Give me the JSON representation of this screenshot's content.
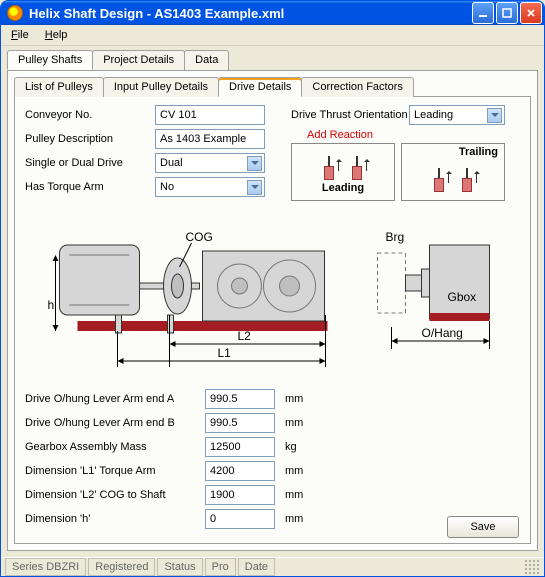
{
  "window": {
    "title": "Helix Shaft Design - AS1403 Example.xml"
  },
  "menu": {
    "file": "File",
    "help": "Help"
  },
  "outer_tabs": {
    "pulley_shafts": "Pulley Shafts",
    "project_details": "Project Details",
    "data": "Data"
  },
  "inner_tabs": {
    "list": "List of Pulleys",
    "input": "Input Pulley Details",
    "drive": "Drive Details",
    "correction": "Correction Factors"
  },
  "fields": {
    "conveyor_no_label": "Conveyor No.",
    "conveyor_no_value": "CV 101",
    "pulley_desc_label": "Pulley Description",
    "pulley_desc_value": "As 1403 Example",
    "single_dual_label": "Single or Dual Drive",
    "single_dual_value": "Dual",
    "torque_arm_label": "Has Torque Arm",
    "torque_arm_value": "No",
    "thrust_label": "Drive Thrust Orientation",
    "thrust_value": "Leading"
  },
  "reaction": {
    "header": "Add Reaction",
    "leading": "Leading",
    "trailing": "Trailing"
  },
  "diagram": {
    "cog": "COG",
    "brg": "Brg",
    "gbox": "Gbox",
    "l1": "L1",
    "l2": "L2",
    "h": "h",
    "ohang": "O/Hang"
  },
  "lower": {
    "a_label": "Drive O/hung Lever Arm end A",
    "a_value": "990.5",
    "a_unit": "mm",
    "b_label": "Drive O/hung Lever Arm end B",
    "b_value": "990.5",
    "b_unit": "mm",
    "mass_label": "Gearbox Assembly Mass",
    "mass_value": "12500",
    "mass_unit": "kg",
    "l1_label": "Dimension 'L1' Torque Arm",
    "l1_value": "4200",
    "l1_unit": "mm",
    "l2_label": "Dimension 'L2' COG to Shaft",
    "l2_value": "1900",
    "l2_unit": "mm",
    "h_label": "Dimension 'h'",
    "h_value": "0",
    "h_unit": "mm"
  },
  "buttons": {
    "save": "Save"
  },
  "status": {
    "series": "Series DBZRI",
    "registered": "Registered",
    "status": "Status",
    "pro": "Pro",
    "date": "Date"
  }
}
